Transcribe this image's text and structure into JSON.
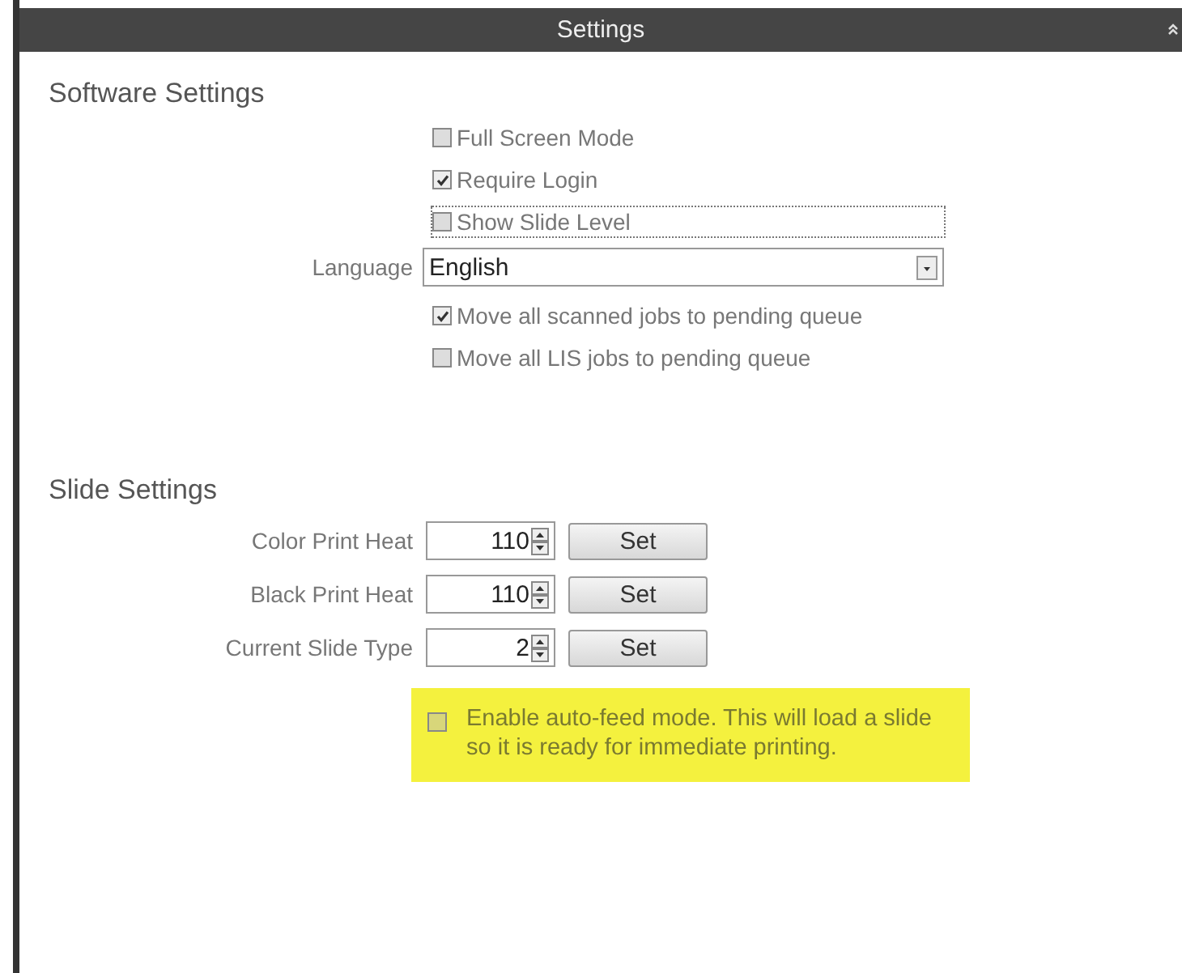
{
  "window": {
    "title": "Settings"
  },
  "software_settings": {
    "heading": "Software Settings",
    "checkboxes": [
      {
        "label": "Full Screen Mode",
        "checked": false,
        "focused": false
      },
      {
        "label": "Require Login",
        "checked": true,
        "focused": false
      },
      {
        "label": "Show Slide Level",
        "checked": false,
        "focused": true
      }
    ],
    "language": {
      "label": "Language",
      "value": "English"
    },
    "queue_checkboxes": [
      {
        "label": "Move all scanned jobs to pending queue",
        "checked": true
      },
      {
        "label": "Move all LIS jobs to pending queue",
        "checked": false
      }
    ]
  },
  "slide_settings": {
    "heading": "Slide Settings",
    "rows": [
      {
        "label": "Color Print Heat",
        "value": "110",
        "button": "Set"
      },
      {
        "label": "Black Print Heat",
        "value": "110",
        "button": "Set"
      },
      {
        "label": "Current Slide Type",
        "value": "2",
        "button": "Set"
      }
    ],
    "auto_feed": {
      "label": "Enable auto-feed mode. This will load a slide so it is ready for immediate printing.",
      "checked": false
    }
  }
}
